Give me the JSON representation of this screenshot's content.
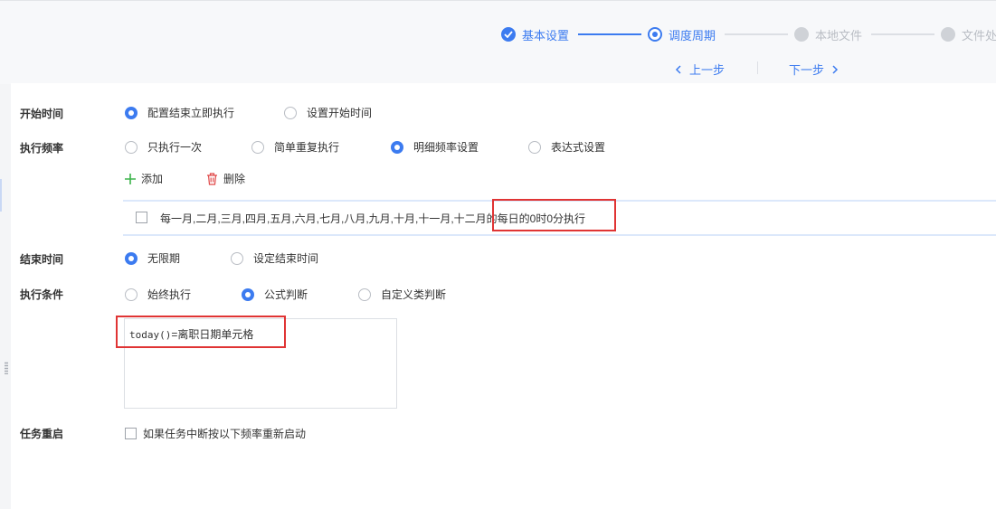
{
  "steps": [
    {
      "label": "基本设置",
      "state": "done"
    },
    {
      "label": "调度周期",
      "state": "active"
    },
    {
      "label": "本地文件",
      "state": "todo"
    },
    {
      "label": "文件处",
      "state": "todo"
    }
  ],
  "nav": {
    "prev": "上一步",
    "next": "下一步"
  },
  "form": {
    "start_time": {
      "label": "开始时间",
      "options": [
        "配置结束立即执行",
        "设置开始时间"
      ],
      "selected": "配置结束立即执行"
    },
    "frequency": {
      "label": "执行频率",
      "options": [
        "只执行一次",
        "简单重复执行",
        "明细频率设置",
        "表达式设置"
      ],
      "selected": "明细频率设置",
      "add_label": "添加",
      "delete_label": "删除",
      "rule_text": "每一月,二月,三月,四月,五月,六月,七月,八月,九月,十月,十一月,十二月的每日的0时0分执行"
    },
    "end_time": {
      "label": "结束时间",
      "options": [
        "无限期",
        "设定结束时间"
      ],
      "selected": "无限期"
    },
    "condition": {
      "label": "执行条件",
      "options": [
        "始终执行",
        "公式判断",
        "自定义类判断"
      ],
      "selected": "公式判断",
      "formula_code": "today()",
      "formula_rest": "=离职日期单元格"
    },
    "restart": {
      "label": "任务重启",
      "checkbox_label": "如果任务中断按以下频率重新启动",
      "checked": false
    }
  },
  "colors": {
    "accent": "#3c7bf0",
    "highlight_box": "#e03434",
    "inactive": "#cfd2d7"
  }
}
